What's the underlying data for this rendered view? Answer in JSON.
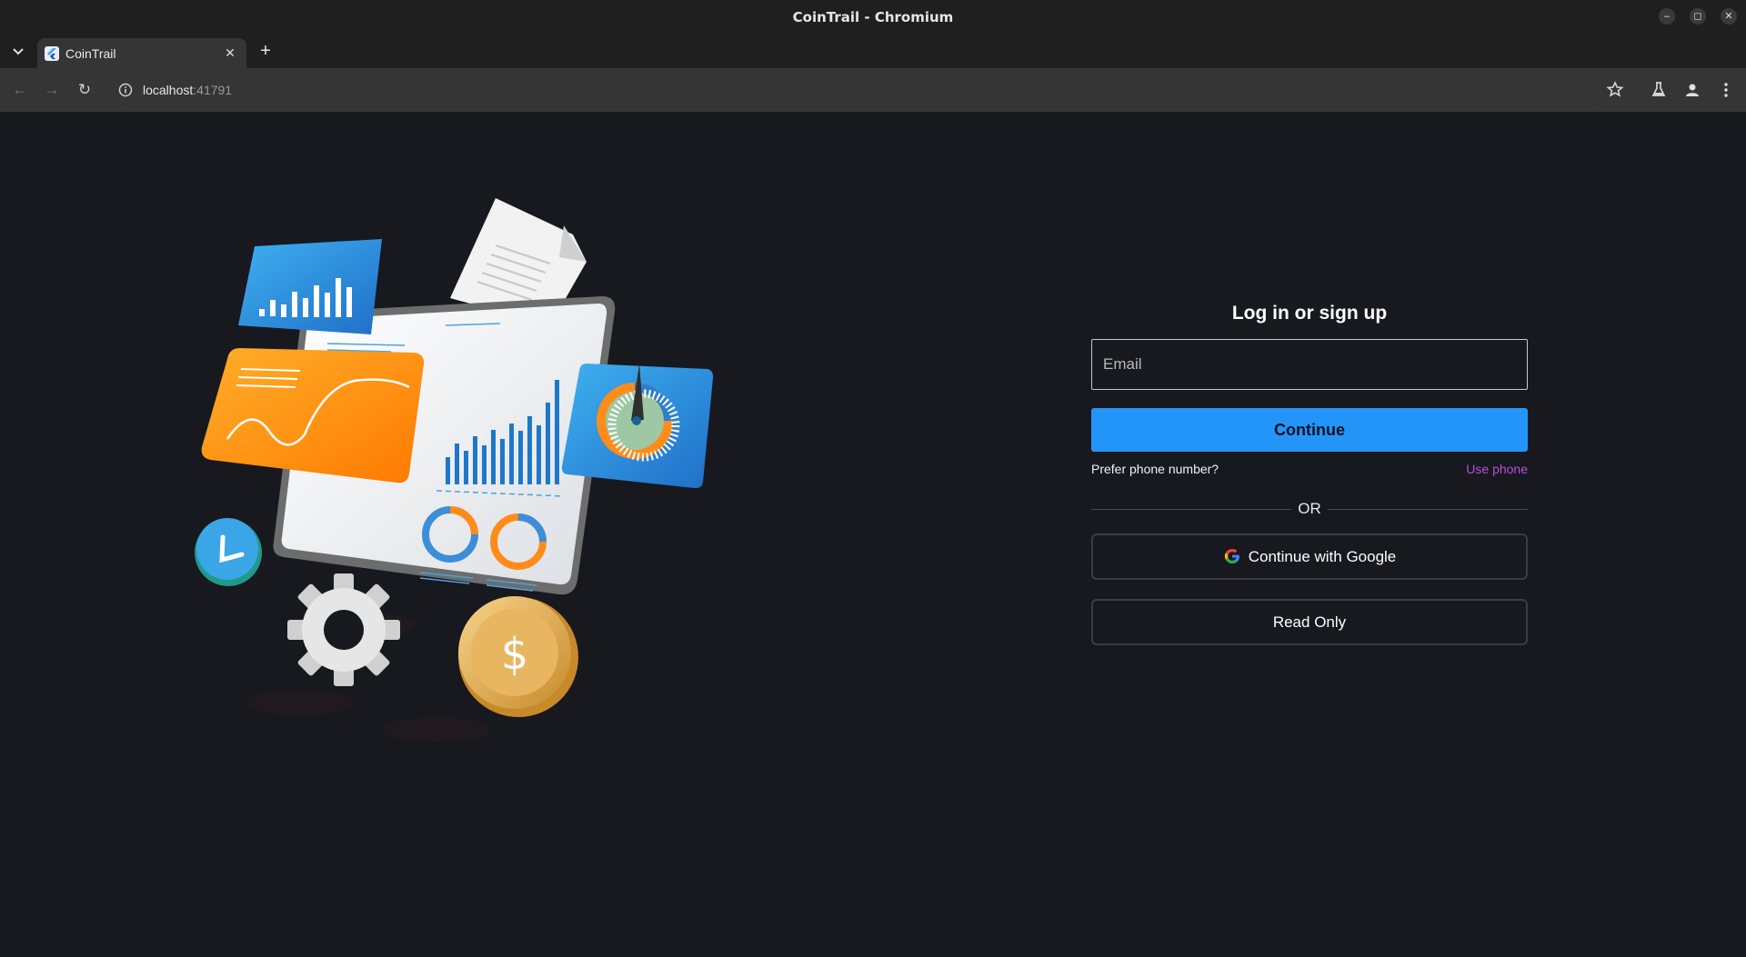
{
  "window": {
    "title": "CoinTrail - Chromium"
  },
  "tabs": [
    {
      "title": "CoinTrail"
    }
  ],
  "address_bar": {
    "host": "localhost",
    "port": ":41791"
  },
  "login": {
    "heading": "Log in or sign up",
    "email_placeholder": "Email",
    "continue_label": "Continue",
    "prefer_phone_text": "Prefer phone number?",
    "use_phone_label": "Use phone",
    "or_text": "OR",
    "google_label": "Continue with Google",
    "read_only_label": "Read Only"
  },
  "colors": {
    "background": "#18181f",
    "primary": "#2495f8",
    "link": "#b552d9"
  },
  "illustration": {
    "coin_symbol": "$"
  }
}
